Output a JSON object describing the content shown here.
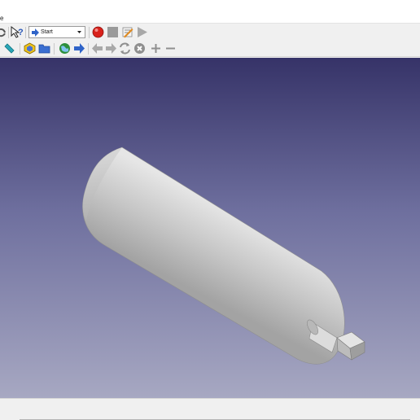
{
  "menubar": {
    "text": "e"
  },
  "toolbar1": {
    "macro_dropdown": {
      "selected": "Start"
    },
    "icons": [
      "refresh-icon",
      "whats-this-icon",
      "record-macro-icon",
      "stop-macro-icon",
      "edit-macro-icon",
      "run-macro-icon"
    ],
    "colors": {
      "record": "#d9211b",
      "stop": "#9a9a9a",
      "run": "#a8a8a8"
    }
  },
  "toolbar2": {
    "icons": [
      "measure-icon",
      "part-icon",
      "folder-icon",
      "web-home-icon",
      "web-forward-icon",
      "back-icon",
      "forward-icon",
      "reload-icon",
      "stop-icon",
      "zoom-in-icon",
      "zoom-out-icon"
    ]
  },
  "viewport": {
    "background_top": "#363368",
    "background_bottom": "#a7a8c2",
    "model": "capsule-solid-with-shaft",
    "model_color": "#c9c9c9"
  }
}
